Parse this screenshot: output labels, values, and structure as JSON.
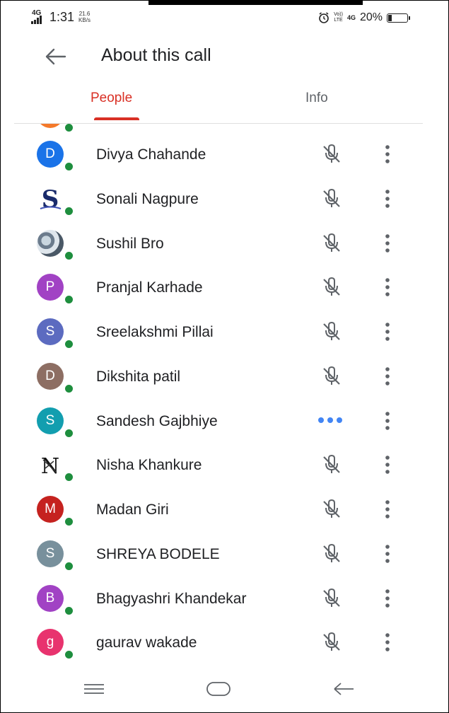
{
  "status_bar": {
    "network": "4G",
    "time": "1:31",
    "speed_value": "21.6",
    "speed_unit": "KB/s",
    "volte_top": "Vo))",
    "volte_bottom": "LTE",
    "network_right": "4G",
    "battery": "20%",
    "battery_level": 0.2
  },
  "appbar": {
    "title": "About this call",
    "back_icon": "arrow-left-icon"
  },
  "tabs": [
    {
      "label": "People",
      "active": true
    },
    {
      "label": "Info",
      "active": false
    }
  ],
  "participants": [
    {
      "name": "Divya Chahande",
      "initial": "D",
      "color": "#1a73e8",
      "avatar_type": "initial",
      "status": "muted"
    },
    {
      "name": "Sonali Nagpure",
      "initial": "S",
      "color": "",
      "avatar_type": "image-s",
      "status": "muted"
    },
    {
      "name": "Sushil Bro",
      "initial": "",
      "color": "",
      "avatar_type": "photo",
      "status": "muted"
    },
    {
      "name": "Pranjal Karhade",
      "initial": "P",
      "color": "#a142c4",
      "avatar_type": "initial",
      "status": "muted"
    },
    {
      "name": "Sreelakshmi Pillai",
      "initial": "S",
      "color": "#5c6bc0",
      "avatar_type": "initial",
      "status": "muted"
    },
    {
      "name": "Dikshita patil",
      "initial": "D",
      "color": "#8d6e63",
      "avatar_type": "initial",
      "status": "muted"
    },
    {
      "name": "Sandesh Gajbhiye",
      "initial": "S",
      "color": "#129eaf",
      "avatar_type": "initial",
      "status": "speaking"
    },
    {
      "name": "Nisha Khankure",
      "initial": "N",
      "color": "",
      "avatar_type": "image-n",
      "status": "muted"
    },
    {
      "name": "Madan Giri",
      "initial": "M",
      "color": "#c5221f",
      "avatar_type": "initial",
      "status": "muted"
    },
    {
      "name": "SHREYA BODELE",
      "initial": "S",
      "color": "#78909c",
      "avatar_type": "initial",
      "status": "muted"
    },
    {
      "name": "Bhagyashri Khandekar",
      "initial": "B",
      "color": "#a142c4",
      "avatar_type": "initial",
      "status": "muted"
    },
    {
      "name": "gaurav wakade",
      "initial": "g",
      "color": "#e8336e",
      "avatar_type": "initial",
      "status": "muted"
    }
  ],
  "nav": {
    "menu_icon": "menu-icon",
    "home_icon": "home-icon",
    "back_icon": "back-icon"
  }
}
